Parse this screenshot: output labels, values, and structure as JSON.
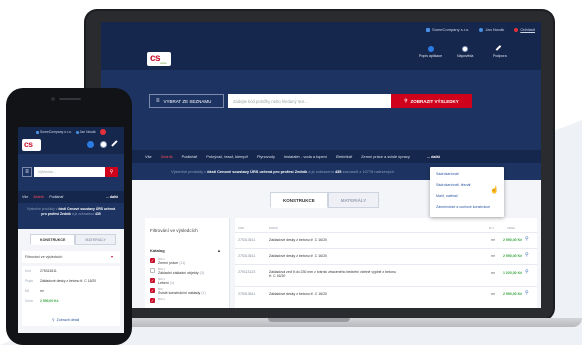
{
  "laptop": {
    "topbar": {
      "company": "SomeCompany s.r.o.",
      "user": "Jan Novák",
      "logout": "Odhlásit"
    },
    "logo": {
      "text": "cs",
      "sub": "online"
    },
    "quick_links": [
      {
        "label": "Popis aplikace",
        "icon": "info-icon",
        "color": "#2c7be5"
      },
      {
        "label": "Nápověda",
        "icon": "lifebuoy-icon",
        "color": "#ffffff"
      },
      {
        "label": "Podpora",
        "icon": "wrench-icon",
        "color": "#ffffff"
      }
    ],
    "menu_button": "VYBRAT ZE SEZNAMU",
    "search_placeholder": "Zadejte kód položky nebo hledaný text...",
    "search_button": "ZOBRAZIT VÝSLEDKY",
    "categories": [
      "Vše",
      "Zedník",
      "Podlahář",
      "Pokrývač, tesař, klempíř",
      "Plynovody",
      "Instalatér - voda a topení",
      "Elektrikář",
      "Zemní práce a svislé úpravy"
    ],
    "categories_more": "... další",
    "info": {
      "prefix": "Výsledné produkty v ",
      "bold1": "části Cenové soustavy ÚRS určená pro profesi Zedník",
      "middle": " a je zobrazeno ",
      "bold2": "435",
      "suffix": " záznamů z 10776 nalezených"
    },
    "tabs": [
      "KONSTRUKCE",
      "MATERIÁLY"
    ],
    "filter": {
      "title": "Filtrování ve výsledcích",
      "catalog": "Katalog",
      "caret": "▲",
      "items": [
        {
          "code": "800-1",
          "name": "Zemní práce",
          "count": "(11)"
        },
        {
          "code": "800-1",
          "name": "Základní základní objekty",
          "count": "(3)"
        },
        {
          "code": "800-1",
          "name": "Lešení",
          "count": "(1)"
        },
        {
          "code": "800",
          "name": "Svislé konstrukční náklady",
          "count": "(1)"
        },
        {
          "code": "800-1",
          "name": "",
          "count": ""
        }
      ]
    },
    "table": {
      "headers": [
        "KÓD",
        "POPIS",
        "M.J.",
        "CENA"
      ],
      "rows": [
        {
          "code": "275313611",
          "desc": "Základové desky z betonu tř. C 16/20",
          "unit": "m³",
          "price": "2 590,00 Kč"
        },
        {
          "code": "275313611",
          "desc": "Základové desky z betonu tř. C 16/20",
          "unit": "m³",
          "price": "2 590,00 Kč"
        },
        {
          "code": "279113123",
          "desc": "Základová zeď tl do 230 mm z tvárnic ztraceného bednění včetně výplně z betonu tř. C 16/20",
          "unit": "m²",
          "price": "1 020,00 Kč"
        },
        {
          "code": "275313611",
          "desc": "Základové desky z betonu tř. C 16/20",
          "unit": "m³",
          "price": "2 590,00 Kč"
        }
      ]
    },
    "dropdown": [
      "Sádrokartonář",
      "Sádrokartonář, těsnář",
      "Malíř, natěrač",
      "Zámečnické a ocelové konstrukce"
    ]
  },
  "phone": {
    "topbar": {
      "company": "SomeCompany s.r.o.",
      "user": "Jan Novák"
    },
    "logo": "cs",
    "search_placeholder": "Vyhledat...",
    "categories": [
      "Vše",
      "Zedník",
      "Podlahář"
    ],
    "categories_more": "... další",
    "info": {
      "prefix": "Výsledné produkty v ",
      "bold1": "části Cenové soustavy ÚRS určená pro profesi Zedník",
      "middle": " a je zobrazeno ",
      "bold2": "435"
    },
    "tabs": [
      "KONSTRUKCE",
      "MATERIÁLY"
    ],
    "filter_label": "Filtrování ve výsledcích",
    "card": {
      "rows": [
        {
          "k": "Kód",
          "v": "275313611"
        },
        {
          "k": "Popis",
          "v": "Základové desky z betonu tř. C 16/20"
        },
        {
          "k": "MJ",
          "v": "m³"
        },
        {
          "k": "Cena",
          "v": "2 590,00 Kč"
        }
      ],
      "detail": "Zobrazit detail"
    }
  },
  "colors": {
    "navy": "#16274e",
    "navy_light": "#1d3463",
    "red": "#d0021b",
    "price_green": "#36a43c",
    "link_blue": "#2c55a0"
  }
}
